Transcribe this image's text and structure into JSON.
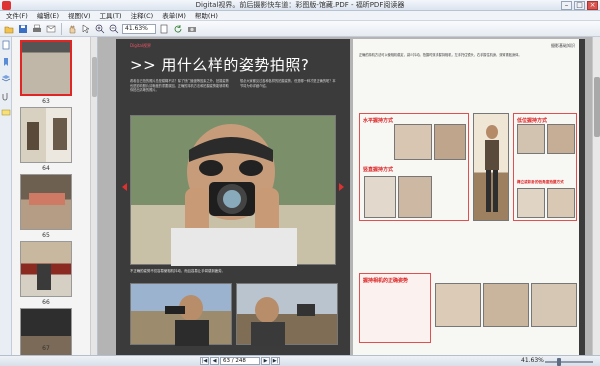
{
  "window": {
    "title": "Digital视界。前后摄影快车道：彩图版-馆藏.PDF - 福昕PDF阅读器",
    "controls": [
      "minimize",
      "maximize",
      "close"
    ]
  },
  "menu": {
    "items": [
      "文件(F)",
      "编辑(E)",
      "视图(V)",
      "工具(T)",
      "注释(C)",
      "表单(M)",
      "帮助(H)"
    ]
  },
  "toolbar": {
    "zoom_value": "41.63%",
    "icons": [
      "open-icon",
      "save-icon",
      "print-icon",
      "email-icon",
      "hand-icon",
      "select-icon",
      "zoom-in-icon",
      "zoom-out-icon",
      "fit-page-icon",
      "rotate-icon",
      "snapshot-icon"
    ]
  },
  "thumbnails": {
    "items": [
      {
        "label": "63",
        "active": true
      },
      {
        "label": "64",
        "active": false
      },
      {
        "label": "65",
        "active": false
      },
      {
        "label": "66",
        "active": false
      },
      {
        "label": "67",
        "active": false
      }
    ]
  },
  "page_left": {
    "heading": ">> 用什么样的姿势拍照?",
    "brand": "Digital视界",
    "caption_main": "不正确的姿势不仅容易使相机抖动，而且容易让手臂感到疲劳。",
    "body_intro": "看着自己拍的照片总是模糊不清？除了快门速度等因素之外，拍摄姿势也是影响照片清晰度的重要原因。正确的持机方法和拍摄姿势能够帮助你拍出清晰的照片。",
    "body_right": "想必大家都见过各种各样的拍摄姿势，但是哪一种才是正确的呢？本节将为你详细介绍。"
  },
  "page_right": {
    "section_title": "摄影基础知识",
    "body_top": "正确的持机方法可以使相机稳定，减少抖动。拍摄时双手握持相机，左手托住镜头，右手握住机身，双臂紧贴身体。",
    "sections": {
      "horizontal": "水平握持方式",
      "vertical": "竖直握持方式",
      "low_angle": "低位握持方式",
      "low_angle_2": "蹲立或趴卧的低角度拍摄方式",
      "tips": "握持相机的正确姿势"
    }
  },
  "statusbar": {
    "page_value": "63 / 248",
    "zoom_label": "41.63%"
  },
  "colors": {
    "accent_red": "#e02525",
    "doc_background": "#b4b4b4",
    "page_dark": "#3b3b3b"
  }
}
